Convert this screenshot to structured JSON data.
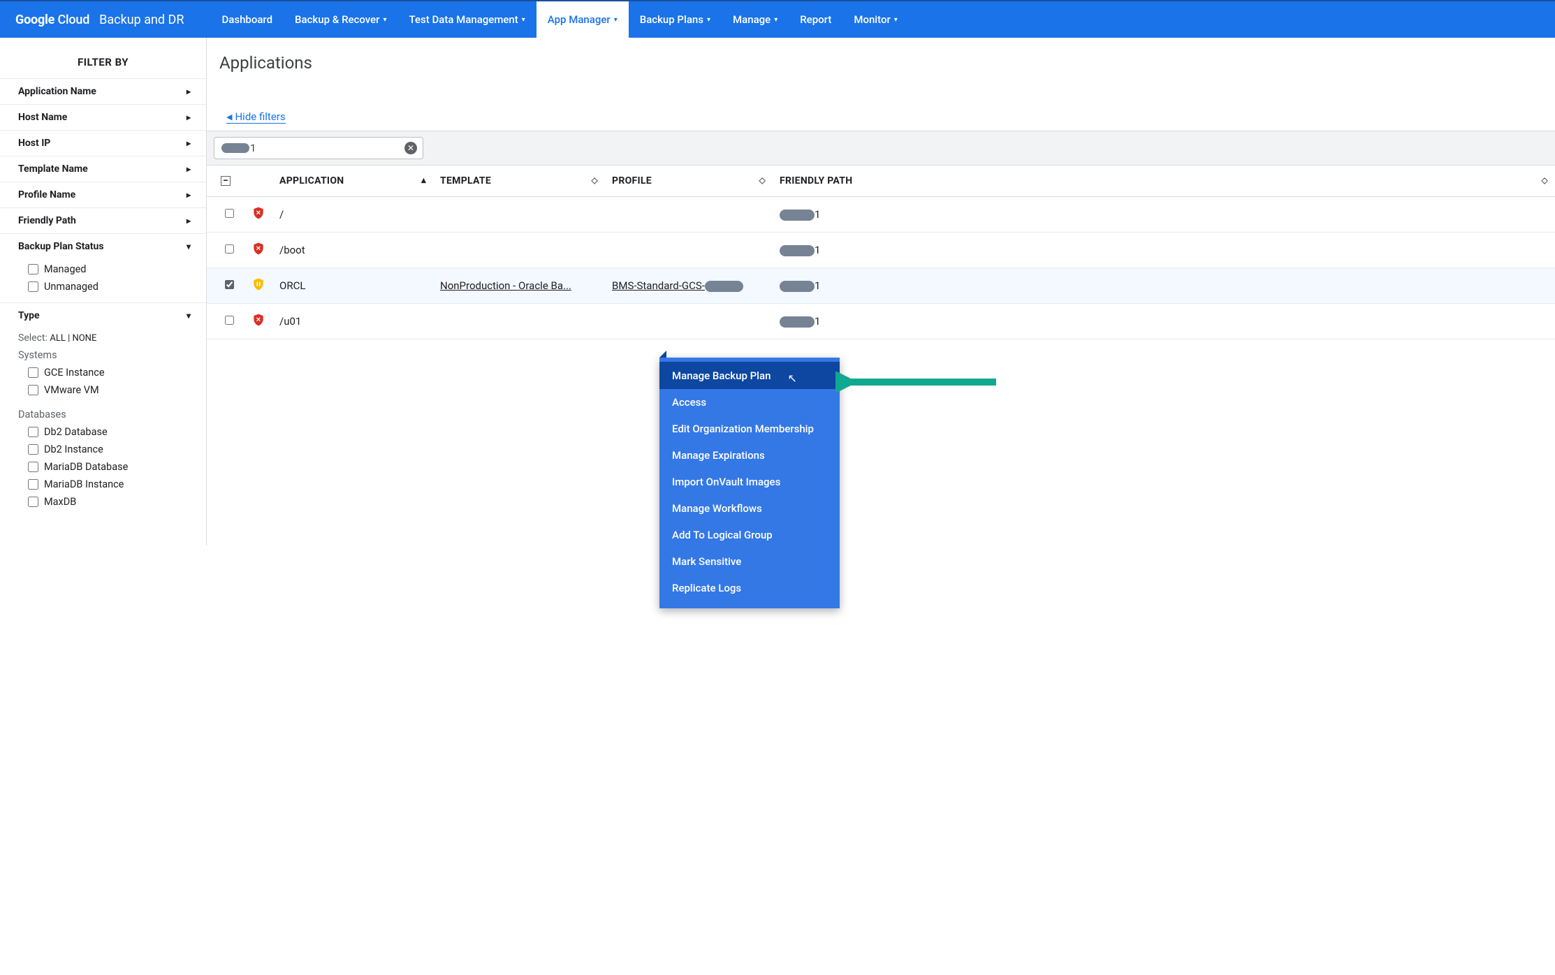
{
  "brand": {
    "logo_prefix": "Google",
    "logo_suffix": " Cloud",
    "product": "Backup and DR"
  },
  "nav": {
    "items": [
      {
        "label": "Dashboard",
        "dropdown": false
      },
      {
        "label": "Backup & Recover",
        "dropdown": true
      },
      {
        "label": "Test Data Management",
        "dropdown": true
      },
      {
        "label": "App Manager",
        "dropdown": true,
        "active": true
      },
      {
        "label": "Backup Plans",
        "dropdown": true
      },
      {
        "label": "Manage",
        "dropdown": true
      },
      {
        "label": "Report",
        "dropdown": false
      },
      {
        "label": "Monitor",
        "dropdown": true
      }
    ]
  },
  "sidebar": {
    "title": "FILTER BY",
    "collapsed_filters": [
      "Application Name",
      "Host Name",
      "Host IP",
      "Template Name",
      "Profile Name",
      "Friendly Path"
    ],
    "backup_plan_status": {
      "title": "Backup Plan Status",
      "options": [
        "Managed",
        "Unmanaged"
      ]
    },
    "type_section": {
      "title": "Type",
      "select_label": "Select:",
      "select_all": "ALL",
      "select_sep": " | ",
      "select_none": "NONE",
      "systems_label": "Systems",
      "systems": [
        "GCE Instance",
        "VMware VM"
      ],
      "databases_label": "Databases",
      "databases": [
        "Db2 Database",
        "Db2 Instance",
        "MariaDB Database",
        "MariaDB Instance",
        "MaxDB"
      ]
    }
  },
  "page": {
    "title": "Applications",
    "hide_filters": "Hide filters",
    "chip_suffix": "1"
  },
  "table": {
    "headers": {
      "application": "APPLICATION",
      "template": "TEMPLATE",
      "profile": "PROFILE",
      "friendly": "FRIENDLY PATH"
    },
    "rows": [
      {
        "icon": "red",
        "app": "/",
        "template": "",
        "profile": "",
        "friendly_suffix": "1"
      },
      {
        "icon": "red",
        "app": "/boot",
        "template": "",
        "profile": "",
        "friendly_suffix": "1"
      },
      {
        "icon": "yellow",
        "app": "ORCL",
        "template": "NonProduction - Oracle Ba...",
        "profile_prefix": "BMS-Standard-GCS-",
        "friendly_suffix": "1",
        "selected": true
      },
      {
        "icon": "red",
        "app": "/u01",
        "template": "",
        "profile": "",
        "friendly_suffix": "1"
      }
    ]
  },
  "context_menu": {
    "items": [
      "Manage Backup Plan",
      "Access",
      "Edit Organization Membership",
      "Manage Expirations",
      "Import OnVault Images",
      "Manage Workflows",
      "Add To Logical Group",
      "Mark Sensitive",
      "Replicate Logs"
    ],
    "highlighted": 0
  }
}
